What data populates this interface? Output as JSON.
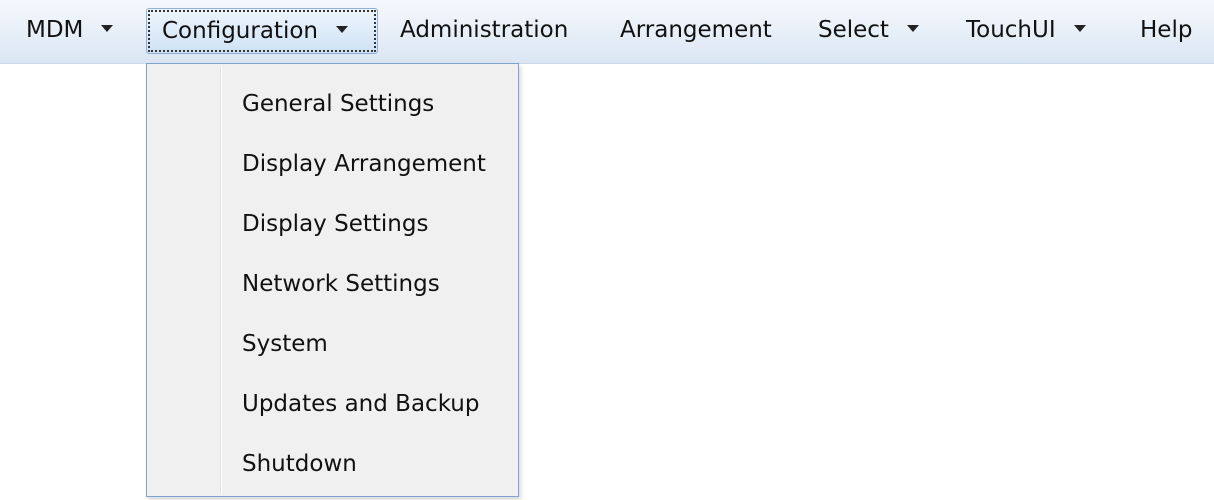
{
  "menubar": {
    "items": [
      {
        "label": "MDM",
        "has_dropdown": true
      },
      {
        "label": "Configuration",
        "has_dropdown": true,
        "active": true
      },
      {
        "label": "Administration",
        "has_dropdown": false
      },
      {
        "label": "Arrangement",
        "has_dropdown": false
      },
      {
        "label": "Select",
        "has_dropdown": true
      },
      {
        "label": "TouchUI",
        "has_dropdown": true
      },
      {
        "label": "Help",
        "has_dropdown": false
      }
    ]
  },
  "configuration_menu": {
    "items": [
      "General Settings",
      "Display Arrangement",
      "Display Settings",
      "Network Settings",
      "System",
      "Updates and Backup",
      "Shutdown"
    ]
  },
  "colors": {
    "menubar_bg": "#e6eef7",
    "dropdown_bg": "#f0f0f0",
    "dropdown_border": "#7fa3cf",
    "active_item_border": "#8fb1d8"
  },
  "icons": {
    "dropdown_caret": "caret-down-icon"
  }
}
